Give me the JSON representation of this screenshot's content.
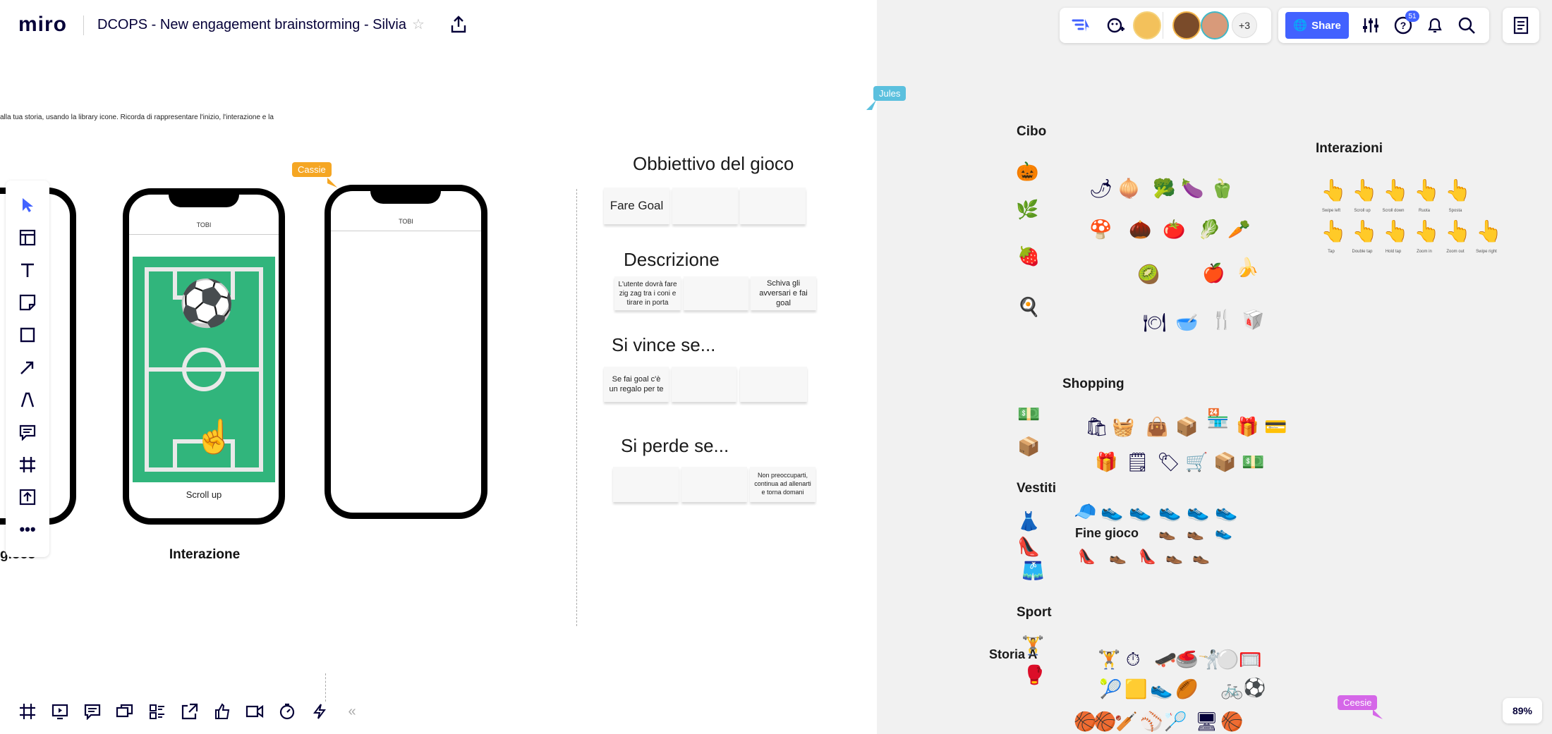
{
  "app": {
    "logo": "miro",
    "board_title": "DCOPS - New engagement brainstorming - Silvia",
    "zoom": "89%"
  },
  "header": {
    "share_label": "Share",
    "avatar_more": "+3",
    "help_badge": "51"
  },
  "instruction_text": "alla tua storia, usando la library icone. Ricorda di rappresentare l'inizio, l'interazione e la",
  "cursors": [
    {
      "name": "Jules",
      "color": "#5bc0de"
    },
    {
      "name": "Cassie",
      "color": "#f5a623"
    },
    {
      "name": "Ceesie",
      "color": "#d567e8"
    }
  ],
  "phones": {
    "screen_header": "TOBI",
    "scroll_label": "Scroll up",
    "label_left_partial": "gioco",
    "label_middle": "Interazione"
  },
  "game_sections": [
    {
      "title": "Obbiettivo del gioco",
      "notes": [
        "Fare Goal",
        "",
        ""
      ]
    },
    {
      "title": "Descrizione",
      "notes": [
        "L'utente dovrà fare zig zag tra i coni e tirare in porta",
        "",
        "Schiva gli avversari e fai goal"
      ]
    },
    {
      "title": "Si vince se...",
      "notes": [
        "Se fai goal c'è un regalo per te",
        "",
        ""
      ]
    },
    {
      "title": "Si perde se...",
      "notes": [
        "",
        "",
        "Non preoccuparti, continua ad allenarti e torna domani"
      ]
    }
  ],
  "library": {
    "cibo": "Cibo",
    "interazioni": "Interazioni",
    "shopping": "Shopping",
    "vestiti": "Vestiti",
    "fine_gioco": "Fine gioco",
    "sport": "Sport",
    "storia": "Storia A"
  },
  "gestures": [
    "Swipe left",
    "Scroll up",
    "Scroll down",
    "Ruota",
    "Sposta",
    "Tap",
    "Double tap",
    "Hold tap",
    "Zoom in",
    "Zoom out",
    "Swipe right"
  ],
  "left_toolbar": [
    "select-icon",
    "templates-icon",
    "text-icon",
    "sticky-note-icon",
    "shape-icon",
    "arrow-icon",
    "pen-icon",
    "comment-icon",
    "frame-icon",
    "upload-icon",
    "more-icon"
  ],
  "bottom_toolbar": [
    "frames-icon",
    "presentation-icon",
    "comments-icon",
    "cards-icon",
    "board-list-icon",
    "share-screen-icon",
    "vote-icon",
    "video-icon",
    "timer-icon",
    "lightning-icon",
    "collapse-icon"
  ]
}
